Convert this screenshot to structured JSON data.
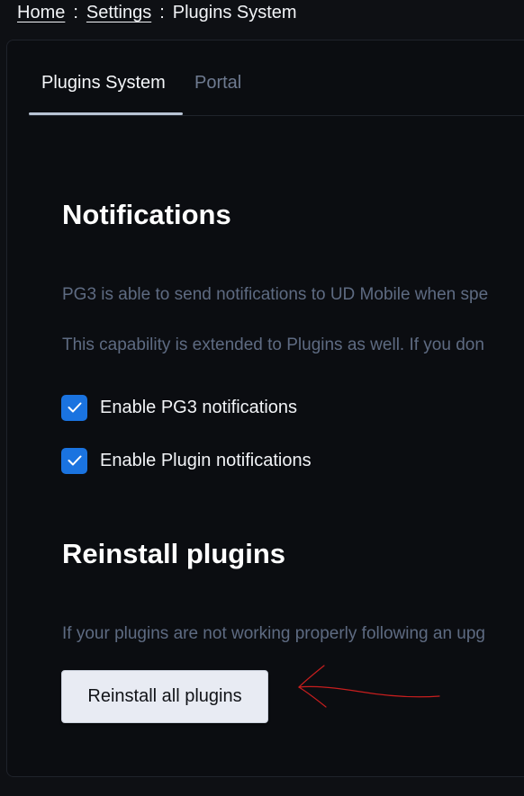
{
  "breadcrumb": {
    "home": "Home",
    "separator": ":",
    "settings": "Settings",
    "current": "Plugins System"
  },
  "tabs": [
    {
      "label": "Plugins System",
      "active": true
    },
    {
      "label": "Portal",
      "active": false
    }
  ],
  "notifications": {
    "title": "Notifications",
    "paragraph1": "PG3 is able to send notifications to UD Mobile when spe",
    "paragraph2": "This capability is extended to Plugins as well. If you don",
    "checkboxes": [
      {
        "label": "Enable PG3 notifications",
        "checked": true
      },
      {
        "label": "Enable Plugin notifications",
        "checked": true
      }
    ]
  },
  "reinstall": {
    "title": "Reinstall plugins",
    "paragraph": "If your plugins are not working properly following an upg",
    "button_label": "Reinstall all plugins"
  },
  "colors": {
    "background": "#0e1014",
    "card": "#0b0d11",
    "checkbox": "#1a73e0",
    "muted_text": "#5e6b82",
    "annotation_arrow": "#c81e1e"
  },
  "icons": {
    "checkbox": "checkmark-icon",
    "annotation": "red-arrow-annotation"
  }
}
